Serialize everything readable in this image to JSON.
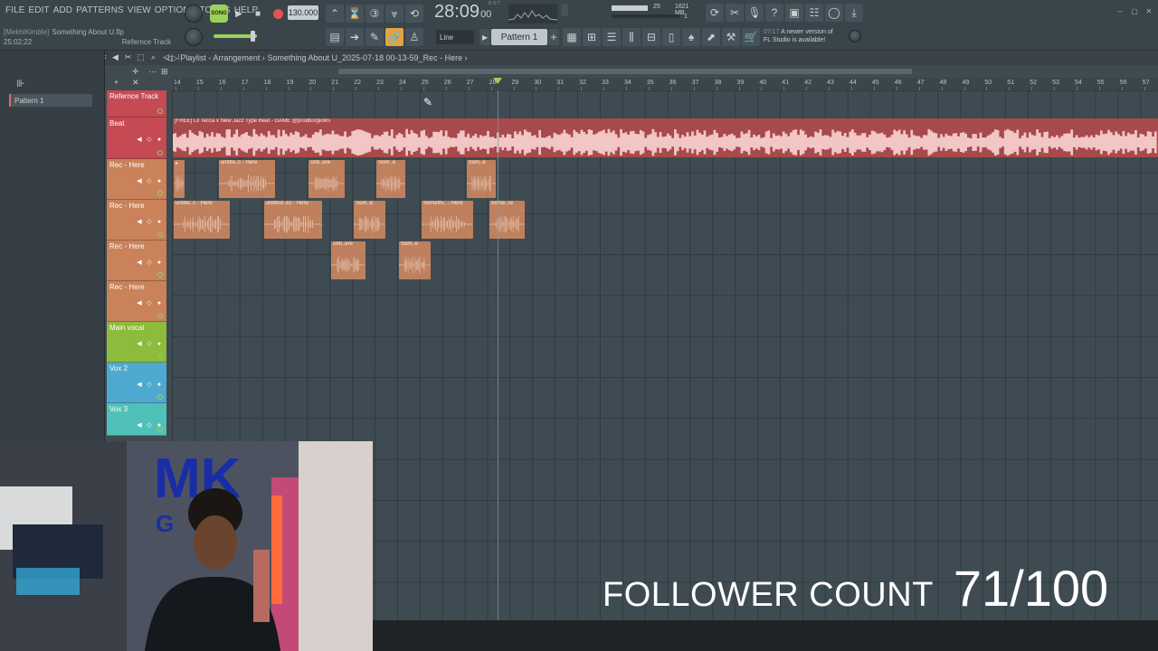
{
  "menu": [
    "FILE",
    "EDIT",
    "ADD",
    "PATTERNS",
    "VIEW",
    "OPTIONS",
    "TOOLS",
    "HELP"
  ],
  "project": {
    "user": "[MekhiKimble]",
    "file": "Something About U.flp",
    "time": "25:02:22",
    "hint": "Refernce Track"
  },
  "transport": {
    "song_label": "SONG",
    "tempo": "130.000",
    "time_main": "28:09",
    "time_sub": "00",
    "time_small": "B:S:T"
  },
  "cpu": {
    "value": "25",
    "memory": "1621 MB",
    "voices": "1"
  },
  "toolbar": {
    "snap": "Line",
    "pattern": "Pattern 1"
  },
  "news": {
    "date": "07/17",
    "line1": "A newer version of",
    "line2": "FL Studio is available!"
  },
  "browser": {
    "pattern_item": "Pattern 1"
  },
  "playlist": {
    "title": "Playlist - Arrangement",
    "breadcrumb": "Something About U_2025-07-18 00-13-59_Rec - Here",
    "ruler_start": 14,
    "ruler_end": 57,
    "playhead_bar": 28.3
  },
  "tracks": [
    {
      "name": "Refernce Track",
      "color": "#c54a53"
    },
    {
      "name": "Beat",
      "color": "#c54a53"
    },
    {
      "name": "Rec - Here",
      "color": "#c9825a"
    },
    {
      "name": "Rec - Here",
      "color": "#c9825a"
    },
    {
      "name": "Rec - Here",
      "color": "#c9825a"
    },
    {
      "name": "Rec - Here",
      "color": "#c9825a"
    },
    {
      "name": "Main vocal",
      "color": "#8dbb3c"
    },
    {
      "name": "Vox 2",
      "color": "#4ea9d0"
    },
    {
      "name": "Vox 3",
      "color": "#50c1b8"
    }
  ],
  "clips": {
    "beat": {
      "label": "[FREE] Lil Tecca x New Jazz Type Beat - GAME @prodborgiolini"
    },
    "rec1": [
      {
        "label": "▸",
        "start": 14.0,
        "end": 14.5
      },
      {
        "label": "untitle..c - Here",
        "start": 16.0,
        "end": 18.5
      },
      {
        "label": "unti..ere",
        "start": 20.0,
        "end": 21.6
      },
      {
        "label": "Som..e",
        "start": 23.0,
        "end": 24.3
      },
      {
        "label": "Som..e",
        "start": 27.0,
        "end": 28.3
      }
    ],
    "rec2": [
      {
        "label": "untitle..c - Here",
        "start": 14.0,
        "end": 16.5
      },
      {
        "label": "untitled..ec - Here",
        "start": 18.0,
        "end": 20.6
      },
      {
        "label": "Som..e",
        "start": 22.0,
        "end": 23.4
      },
      {
        "label": "Somethi.. - Here",
        "start": 25.0,
        "end": 27.3
      },
      {
        "label": "Some..re",
        "start": 28.0,
        "end": 29.6
      }
    ],
    "rec3": [
      {
        "label": "unti..ere",
        "start": 21.0,
        "end": 22.5
      },
      {
        "label": "Som..e",
        "start": 24.0,
        "end": 25.4
      }
    ]
  },
  "overlay": {
    "follower_label": "FOLLOWER COUNT",
    "follower_value": "71/100",
    "sign_text": "MK",
    "sign_sub": "G"
  }
}
